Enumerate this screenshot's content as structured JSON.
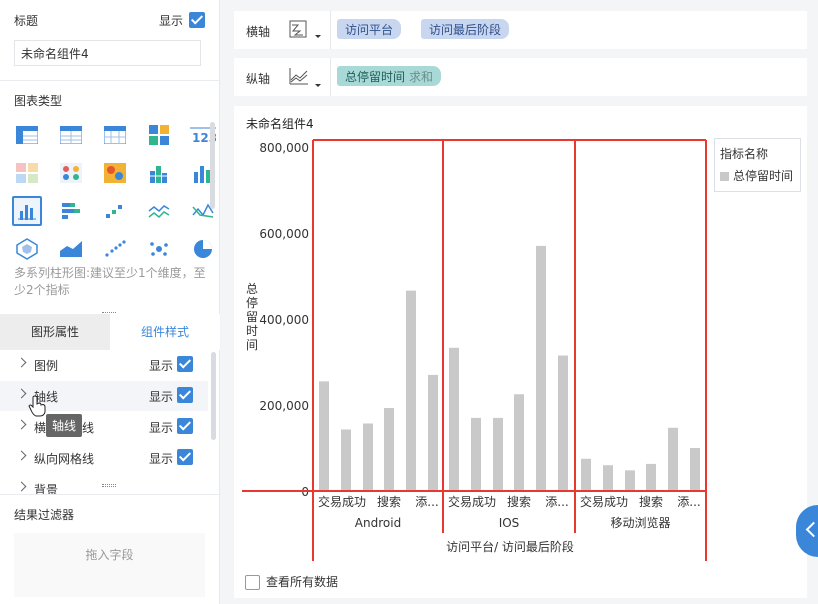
{
  "left": {
    "title_section": {
      "label": "标题",
      "show_label": "显示",
      "title_value": "未命名组件4"
    },
    "chart_type": {
      "label": "图表类型",
      "description": "多系列柱形图:建议至少1个维度，至少2个指标"
    },
    "tabs": [
      {
        "label": "图形属性"
      },
      {
        "label": "组件样式"
      }
    ],
    "props": [
      {
        "label": "图例",
        "show_label": "显示"
      },
      {
        "label": "轴线",
        "show_label": "显示"
      },
      {
        "label": "横向网格线",
        "show_label": "显示"
      },
      {
        "label": "纵向网格线",
        "show_label": "显示"
      },
      {
        "label": "背景"
      }
    ],
    "tooltip": "轴线",
    "filter": {
      "label": "结果过滤器",
      "drop_placeholder": "拖入字段"
    }
  },
  "shelves": {
    "x": {
      "label": "横轴",
      "fields": [
        "访问平台",
        "访问最后阶段"
      ]
    },
    "y": {
      "label": "纵轴",
      "fields": [
        {
          "name": "总停留时间",
          "agg": "求和"
        }
      ]
    }
  },
  "chart": {
    "component_title": "未命名组件4",
    "legend_title": "指标名称",
    "x_axis_title": "访问平台/ 访问最后阶段",
    "highlight_color": "#e8392f",
    "bar_color": "#c9c9c9"
  },
  "chart_data": {
    "type": "bar",
    "ylabel": "总停留时间",
    "xlabel": "访问平台/ 访问最后阶段",
    "ylim": [
      0,
      800000
    ],
    "yticks": [
      "0",
      "200,000",
      "400,000",
      "600,000",
      "800,000"
    ],
    "legend": "top-right",
    "series": [
      {
        "name": "总停留时间"
      }
    ],
    "groups": [
      {
        "name": "Android",
        "tick_labels": [
          "交易成功",
          "搜索",
          "添..."
        ],
        "values": [
          255000,
          143000,
          157000,
          193000,
          466000,
          270000
        ]
      },
      {
        "name": "IOS",
        "tick_labels": [
          "交易成功",
          "搜索",
          "添..."
        ],
        "values": [
          333000,
          170000,
          170000,
          225000,
          570000,
          315000
        ]
      },
      {
        "name": "移动浏览器",
        "tick_labels": [
          "交易成功",
          "搜索",
          "添..."
        ],
        "values": [
          75000,
          60000,
          48000,
          63000,
          147000,
          100000
        ]
      }
    ]
  },
  "footer": {
    "show_all_label": "查看所有数据"
  }
}
